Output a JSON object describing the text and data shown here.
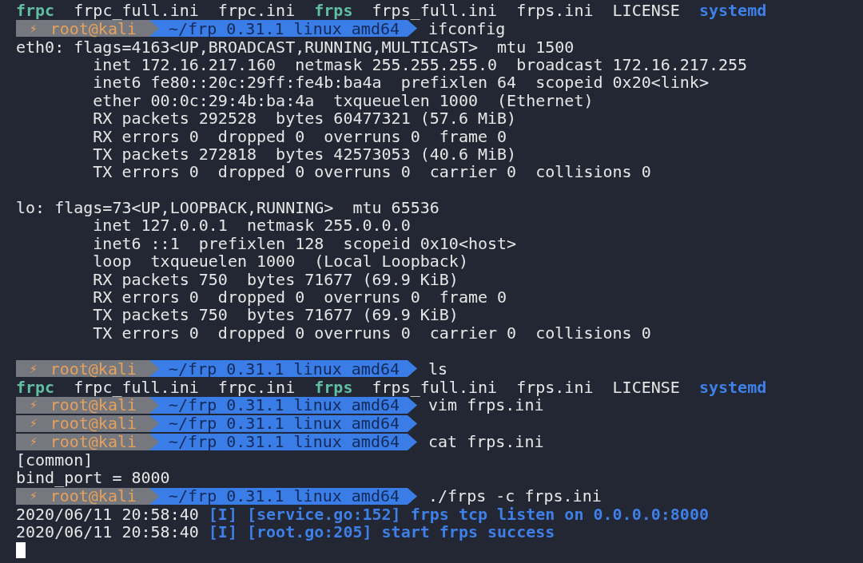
{
  "terminal": {
    "lines": [
      {
        "kind": "text",
        "segments": [
          {
            "kind": "exec",
            "text": "frpc"
          },
          {
            "kind": "plain",
            "text": "  frpc_full.ini  frpc.ini  "
          },
          {
            "kind": "exec",
            "text": "frps"
          },
          {
            "kind": "plain",
            "text": "  frps_full.ini  frps.ini  LICENSE  "
          },
          {
            "kind": "dir",
            "text": "systemd"
          }
        ]
      },
      {
        "kind": "prompt",
        "icon": "⚡",
        "user": "root@kali",
        "path": "~/frp_0.31.1_linux_amd64",
        "command": "ifconfig"
      },
      {
        "kind": "text",
        "segments": [
          {
            "kind": "plain",
            "text": "eth0: flags=4163<UP,BROADCAST,RUNNING,MULTICAST>  mtu 1500"
          }
        ]
      },
      {
        "kind": "text",
        "segments": [
          {
            "kind": "plain",
            "text": "        inet 172.16.217.160  netmask 255.255.255.0  broadcast 172.16.217.255"
          }
        ]
      },
      {
        "kind": "text",
        "segments": [
          {
            "kind": "plain",
            "text": "        inet6 fe80::20c:29ff:fe4b:ba4a  prefixlen 64  scopeid 0x20<link>"
          }
        ]
      },
      {
        "kind": "text",
        "segments": [
          {
            "kind": "plain",
            "text": "        ether 00:0c:29:4b:ba:4a  txqueuelen 1000  (Ethernet)"
          }
        ]
      },
      {
        "kind": "text",
        "segments": [
          {
            "kind": "plain",
            "text": "        RX packets 292528  bytes 60477321 (57.6 MiB)"
          }
        ]
      },
      {
        "kind": "text",
        "segments": [
          {
            "kind": "plain",
            "text": "        RX errors 0  dropped 0  overruns 0  frame 0"
          }
        ]
      },
      {
        "kind": "text",
        "segments": [
          {
            "kind": "plain",
            "text": "        TX packets 272818  bytes 42573053 (40.6 MiB)"
          }
        ]
      },
      {
        "kind": "text",
        "segments": [
          {
            "kind": "plain",
            "text": "        TX errors 0  dropped 0 overruns 0  carrier 0  collisions 0"
          }
        ]
      },
      {
        "kind": "blank"
      },
      {
        "kind": "text",
        "segments": [
          {
            "kind": "plain",
            "text": "lo: flags=73<UP,LOOPBACK,RUNNING>  mtu 65536"
          }
        ]
      },
      {
        "kind": "text",
        "segments": [
          {
            "kind": "plain",
            "text": "        inet 127.0.0.1  netmask 255.0.0.0"
          }
        ]
      },
      {
        "kind": "text",
        "segments": [
          {
            "kind": "plain",
            "text": "        inet6 ::1  prefixlen 128  scopeid 0x10<host>"
          }
        ]
      },
      {
        "kind": "text",
        "segments": [
          {
            "kind": "plain",
            "text": "        loop  txqueuelen 1000  (Local Loopback)"
          }
        ]
      },
      {
        "kind": "text",
        "segments": [
          {
            "kind": "plain",
            "text": "        RX packets 750  bytes 71677 (69.9 KiB)"
          }
        ]
      },
      {
        "kind": "text",
        "segments": [
          {
            "kind": "plain",
            "text": "        RX errors 0  dropped 0  overruns 0  frame 0"
          }
        ]
      },
      {
        "kind": "text",
        "segments": [
          {
            "kind": "plain",
            "text": "        TX packets 750  bytes 71677 (69.9 KiB)"
          }
        ]
      },
      {
        "kind": "text",
        "segments": [
          {
            "kind": "plain",
            "text": "        TX errors 0  dropped 0 overruns 0  carrier 0  collisions 0"
          }
        ]
      },
      {
        "kind": "blank"
      },
      {
        "kind": "prompt",
        "icon": "⚡",
        "user": "root@kali",
        "path": "~/frp_0.31.1_linux_amd64",
        "command": "ls"
      },
      {
        "kind": "text",
        "segments": [
          {
            "kind": "exec",
            "text": "frpc"
          },
          {
            "kind": "plain",
            "text": "  frpc_full.ini  frpc.ini  "
          },
          {
            "kind": "exec",
            "text": "frps"
          },
          {
            "kind": "plain",
            "text": "  frps_full.ini  frps.ini  LICENSE  "
          },
          {
            "kind": "dir",
            "text": "systemd"
          }
        ]
      },
      {
        "kind": "prompt",
        "icon": "⚡",
        "user": "root@kali",
        "path": "~/frp_0.31.1_linux_amd64",
        "command": "vim frps.ini"
      },
      {
        "kind": "prompt",
        "icon": "⚡",
        "user": "root@kali",
        "path": "~/frp_0.31.1_linux_amd64"
      },
      {
        "kind": "prompt",
        "icon": "⚡",
        "user": "root@kali",
        "path": "~/frp_0.31.1_linux_amd64",
        "command": "cat frps.ini"
      },
      {
        "kind": "text",
        "segments": [
          {
            "kind": "plain",
            "text": "[common]"
          }
        ]
      },
      {
        "kind": "text",
        "segments": [
          {
            "kind": "plain",
            "text": "bind_port = 8000"
          }
        ]
      },
      {
        "kind": "prompt",
        "icon": "⚡",
        "user": "root@kali",
        "path": "~/frp_0.31.1_linux_amd64",
        "command": "./frps -c frps.ini"
      },
      {
        "kind": "text",
        "segments": [
          {
            "kind": "plain",
            "text": "2020/06/11 20:58:40 "
          },
          {
            "kind": "log",
            "text": "[I] [service.go:152] frps tcp listen on 0.0.0.0:8000"
          }
        ]
      },
      {
        "kind": "text",
        "segments": [
          {
            "kind": "plain",
            "text": "2020/06/11 20:58:40 "
          },
          {
            "kind": "log",
            "text": "[I] [root.go:205] start frps success"
          }
        ]
      },
      {
        "kind": "cursor"
      }
    ]
  }
}
